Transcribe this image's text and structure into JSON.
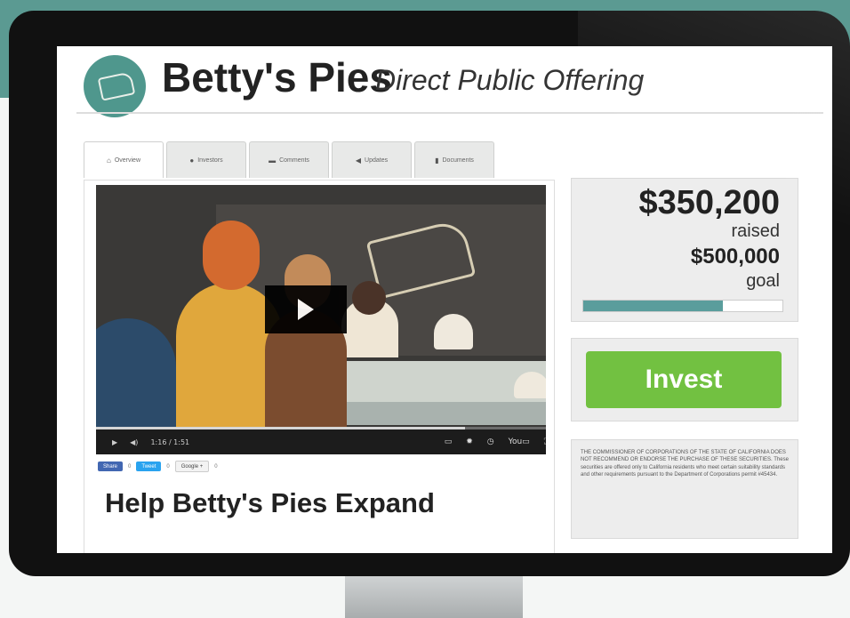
{
  "brand": {
    "name": "Betty's Pies",
    "subtitle": "Direct Public Offering"
  },
  "tabs": [
    {
      "label": "Overview",
      "icon": "home-icon"
    },
    {
      "label": "Investors",
      "icon": "person-icon"
    },
    {
      "label": "Comments",
      "icon": "chat-icon"
    },
    {
      "label": "Updates",
      "icon": "megaphone-icon"
    },
    {
      "label": "Documents",
      "icon": "document-icon"
    }
  ],
  "video": {
    "time": "1:16 / 1:51",
    "progress": 0.82
  },
  "share": {
    "facebook_label": "Share",
    "facebook_count": "0",
    "twitter_label": "Tweet",
    "twitter_count": "0",
    "google_label": "Google +",
    "google_count": "0"
  },
  "headline": "Help Betty's Pies Expand",
  "funding": {
    "raised_amount": "$350,200",
    "raised_label": "raised",
    "goal_amount": "$500,000",
    "goal_label": "goal",
    "progress": 0.7
  },
  "invest_label": "Invest",
  "disclaimer": "THE COMMISSIONER OF CORPORATIONS OF THE STATE OF CALIFORNIA DOES NOT RECOMMEND OR ENDORSE THE PURCHASE OF THESE SECURITIES. These securities are offered only to California residents who meet certain suitability standards and other requirements pursuant to the Department of Corporations permit #45434.",
  "colors": {
    "brand_teal": "#4f978d",
    "invest_green": "#72c141",
    "progress_teal": "#5a9d9c"
  }
}
